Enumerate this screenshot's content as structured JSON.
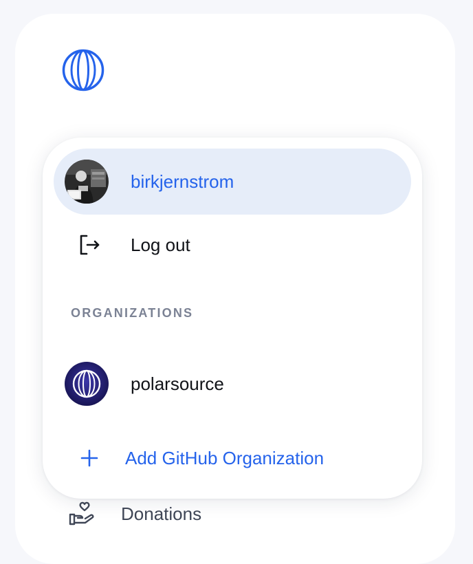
{
  "user": {
    "username": "birkjernstrom"
  },
  "menu": {
    "logout_label": "Log out",
    "organizations_heading": "ORGANIZATIONS",
    "organizations": [
      {
        "name": "polarsource"
      }
    ],
    "add_org_label": "Add GitHub Organization"
  },
  "sidebar": {
    "donations_label": "Donations"
  },
  "colors": {
    "accent": "#2563eb",
    "selected_bg": "#e6edf9",
    "org_avatar_bg": "#1e1b6e"
  },
  "icons": [
    "polar-logo-icon",
    "logout-icon",
    "plus-icon",
    "donations-hand-heart-icon"
  ]
}
